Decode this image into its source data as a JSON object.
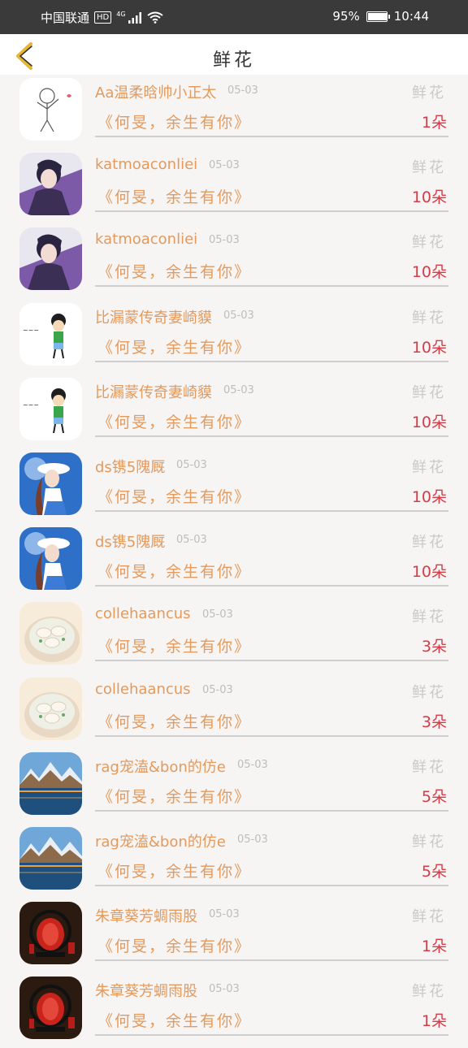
{
  "status_bar": {
    "carrier": "中国联通",
    "hd": "HD",
    "network": "4G",
    "battery": "95%",
    "battery_level": 0.95,
    "time": "10:44"
  },
  "header": {
    "title": "鲜花"
  },
  "colors": {
    "name": "#e49a5c",
    "count": "#d43c48",
    "muted": "#c9c9c9",
    "background": "#f7f4f4"
  },
  "rows": [
    {
      "name": "Aa温柔晗帅小正太",
      "date": "05-03",
      "gift": "鲜花",
      "message": "《何旻，余生有你》",
      "count": "1朵",
      "avatar": "sketch-boy"
    },
    {
      "name": "katmoaconliei",
      "date": "05-03",
      "gift": "鲜花",
      "message": "《何旻，余生有你》",
      "count": "10朵",
      "avatar": "anime-boy"
    },
    {
      "name": "katmoaconliei",
      "date": "05-03",
      "gift": "鲜花",
      "message": "《何旻，余生有你》",
      "count": "10朵",
      "avatar": "anime-boy"
    },
    {
      "name": "比漏蒙传奇妻崎貘",
      "date": "05-03",
      "gift": "鲜花",
      "message": "《何旻，余生有你》",
      "count": "10朵",
      "avatar": "cartoon-kid"
    },
    {
      "name": "比漏蒙传奇妻崎貘",
      "date": "05-03",
      "gift": "鲜花",
      "message": "《何旻，余生有你》",
      "count": "10朵",
      "avatar": "cartoon-kid"
    },
    {
      "name": "ds镌5隗厩",
      "date": "05-03",
      "gift": "鲜花",
      "message": "《何旻，余生有你》",
      "count": "10朵",
      "avatar": "anime-girl"
    },
    {
      "name": "ds镌5隗厩",
      "date": "05-03",
      "gift": "鲜花",
      "message": "《何旻，余生有你》",
      "count": "10朵",
      "avatar": "anime-girl"
    },
    {
      "name": "collehaancus",
      "date": "05-03",
      "gift": "鲜花",
      "message": "《何旻，余生有你》",
      "count": "3朵",
      "avatar": "dumpling-bowl"
    },
    {
      "name": "collehaancus",
      "date": "05-03",
      "gift": "鲜花",
      "message": "《何旻，余生有你》",
      "count": "3朵",
      "avatar": "dumpling-bowl"
    },
    {
      "name": "rag宠溘&bon的仿e",
      "date": "05-03",
      "gift": "鲜花",
      "message": "《何旻，余生有你》",
      "count": "5朵",
      "avatar": "mountain-lake"
    },
    {
      "name": "rag宠溘&bon的仿e",
      "date": "05-03",
      "gift": "鲜花",
      "message": "《何旻，余生有你》",
      "count": "5朵",
      "avatar": "mountain-lake"
    },
    {
      "name": "朱章葵芳蜩雨股",
      "date": "05-03",
      "gift": "鲜花",
      "message": "《何旻，余生有你》",
      "count": "1朵",
      "avatar": "red-lantern"
    },
    {
      "name": "朱章葵芳蜩雨股",
      "date": "05-03",
      "gift": "鲜花",
      "message": "《何旻，余生有你》",
      "count": "1朵",
      "avatar": "red-lantern"
    }
  ]
}
